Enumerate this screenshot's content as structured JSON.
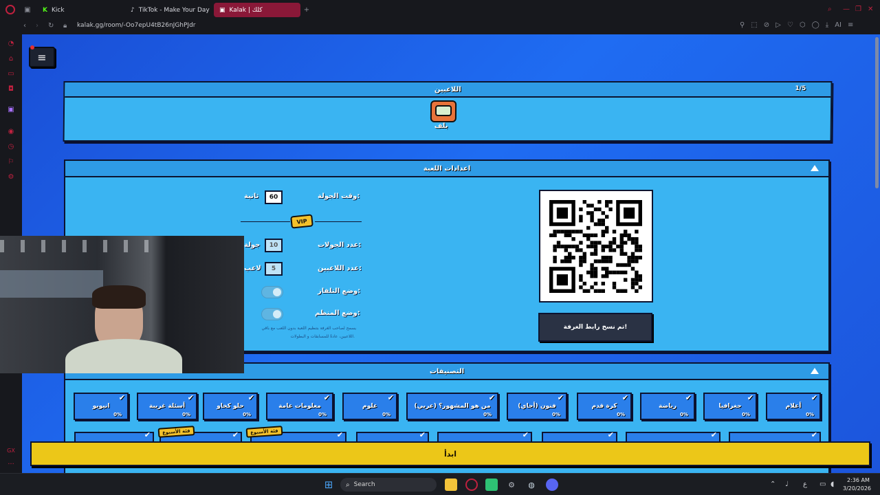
{
  "tabs": [
    {
      "label": "Kick",
      "active": false
    },
    {
      "label": "TikTok - Make Your Day",
      "active": false
    },
    {
      "label": "Kalak | كلك",
      "active": true
    }
  ],
  "address": {
    "url": "kalak.gg/room/-Oo7epU4tB26nJGhPJdr"
  },
  "players_panel": {
    "title": "اللاعبين",
    "count": "1/5",
    "player_name": "بلف"
  },
  "settings_panel": {
    "title": "اعدادات اللعبة",
    "round_time_label": "وقت الجولة:",
    "round_time_value": "60",
    "round_time_unit": "ثانية",
    "vip_label": "VIP",
    "rounds_label": "عدد الجولات:",
    "rounds_value": "10",
    "rounds_unit": "جولة",
    "players_label": "عدد اللاعبين:",
    "players_value": "5",
    "players_unit": "لاعب",
    "tv_mode_label": "وضع التلفاز:",
    "organizer_mode_label": "وضع المنظم:",
    "organizer_note_1": "يسمح لصاحب الغرفة بتنظيم اللعبة بدون اللعب مع باقي",
    "organizer_note_2": "اللاعبين، عادةً للمسابقات و البطولات.",
    "copy_button": "تم نسخ رابط الغرفة!"
  },
  "categories_panel": {
    "title": "التصنيفات",
    "items": [
      {
        "label": "أعلام",
        "pct": "0%"
      },
      {
        "label": "جغرافيا",
        "pct": "0%"
      },
      {
        "label": "رياضة",
        "pct": "0%"
      },
      {
        "label": "كرة قدم",
        "pct": "0%"
      },
      {
        "label": "فنون (أجاي)",
        "pct": "0%"
      },
      {
        "label": "من هو المشهور؟ (عربي)",
        "pct": "0%"
      },
      {
        "label": "علوم",
        "pct": "0%"
      },
      {
        "label": "معلومات عامة",
        "pct": "0%"
      },
      {
        "label": "حلو كخاو",
        "pct": "0%"
      },
      {
        "label": "أسئلة غريبة",
        "pct": "0%"
      },
      {
        "label": "انيويو",
        "pct": "0%"
      }
    ],
    "badge": "فئة الأسبوع"
  },
  "start_button": "ابدأ",
  "taskbar": {
    "search_label": "Search",
    "time": "2:36 AM",
    "date": "3/20/2026"
  },
  "colors": {
    "page_bg": "#1f6cf2",
    "panel_bg": "#3ab4f2",
    "panel_head": "#2e9be6",
    "start_button": "#ecc718",
    "active_tab": "#8a1838"
  }
}
